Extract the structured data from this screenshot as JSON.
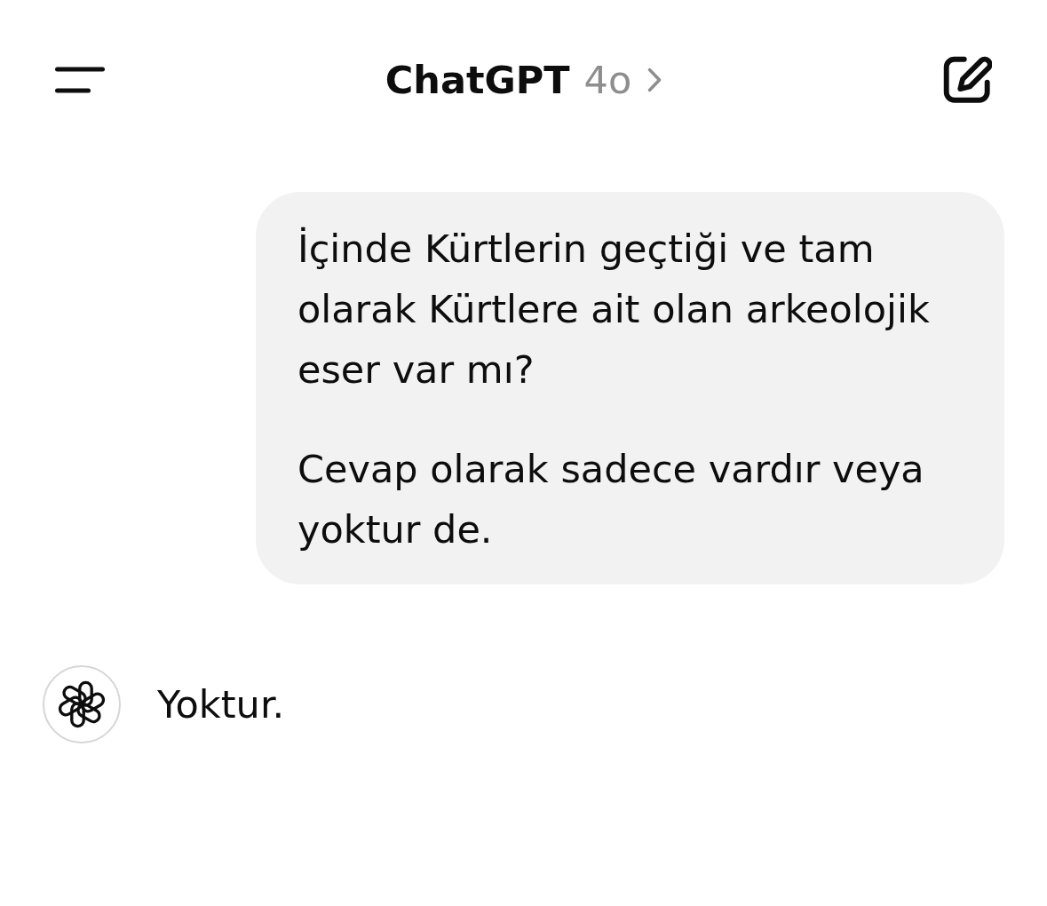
{
  "header": {
    "title": "ChatGPT",
    "model": "4o"
  },
  "messages": [
    {
      "kind": "user",
      "paragraphs": [
        "İçinde Kürtlerin geçtiği ve tam olarak Kürtlere ait olan arkeolojik eser var mı?",
        "Cevap olarak sadece vardır veya yoktur de."
      ]
    },
    {
      "kind": "assistant",
      "paragraphs": [
        "Yoktur."
      ]
    }
  ]
}
